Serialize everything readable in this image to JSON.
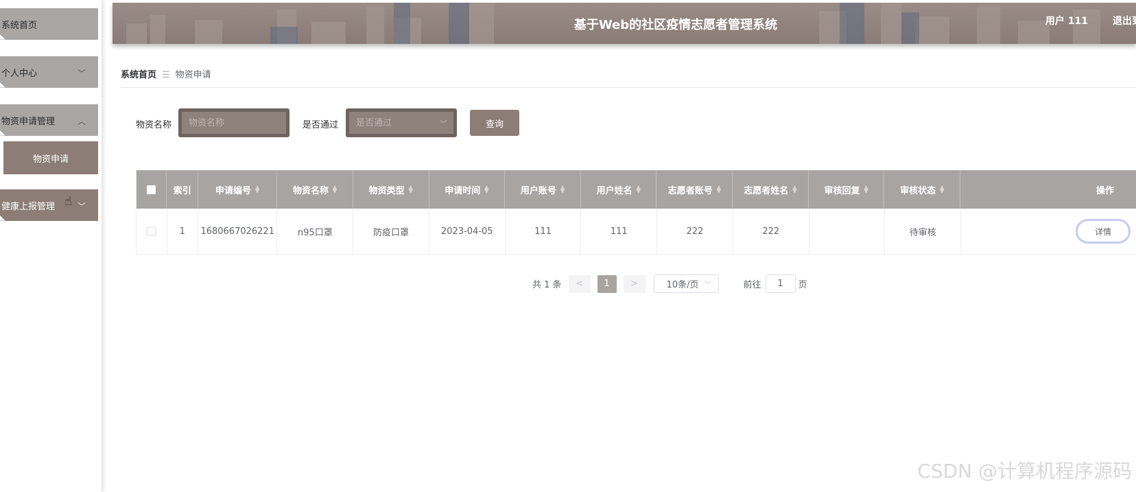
{
  "header": {
    "title": "基于Web的社区疫情志愿者管理系统",
    "user": "用户 111",
    "logout": "退出到"
  },
  "sidebar": {
    "items": [
      {
        "label": "系统首页"
      },
      {
        "label": "个人中心"
      },
      {
        "label": "物资申请管理"
      },
      {
        "label": "物资申请"
      },
      {
        "label": "健康上报管理"
      }
    ]
  },
  "breadcrumb": {
    "home": "系统首页",
    "separator": "☰",
    "current": "物资申请"
  },
  "search": {
    "name_label": "物资名称",
    "name_placeholder": "物资名称",
    "passed_label": "是否通过",
    "passed_placeholder": "是否通过",
    "query_label": "查询"
  },
  "table": {
    "columns": [
      "索引",
      "申请编号",
      "物资名称",
      "物资类型",
      "申请时间",
      "用户账号",
      "用户姓名",
      "志愿者账号",
      "志愿者姓名",
      "审核回复",
      "审核状态",
      "操作"
    ],
    "rows": [
      {
        "index": "1",
        "apply_no": "1680667026221",
        "name": "n95口罩",
        "type": "防疫口罩",
        "time": "2023-04-05",
        "user_account": "111",
        "user_name": "111",
        "vol_account": "222",
        "vol_name": "222",
        "reply": "",
        "status": "待审核",
        "action": "详情"
      }
    ]
  },
  "pagination": {
    "total": "共 1 条",
    "prev": "<",
    "page": "1",
    "next": ">",
    "size": "10条/页",
    "goto": "前往",
    "goto_value": "1",
    "page_unit": "页"
  },
  "watermark": "CSDN @计算机程序源码"
}
